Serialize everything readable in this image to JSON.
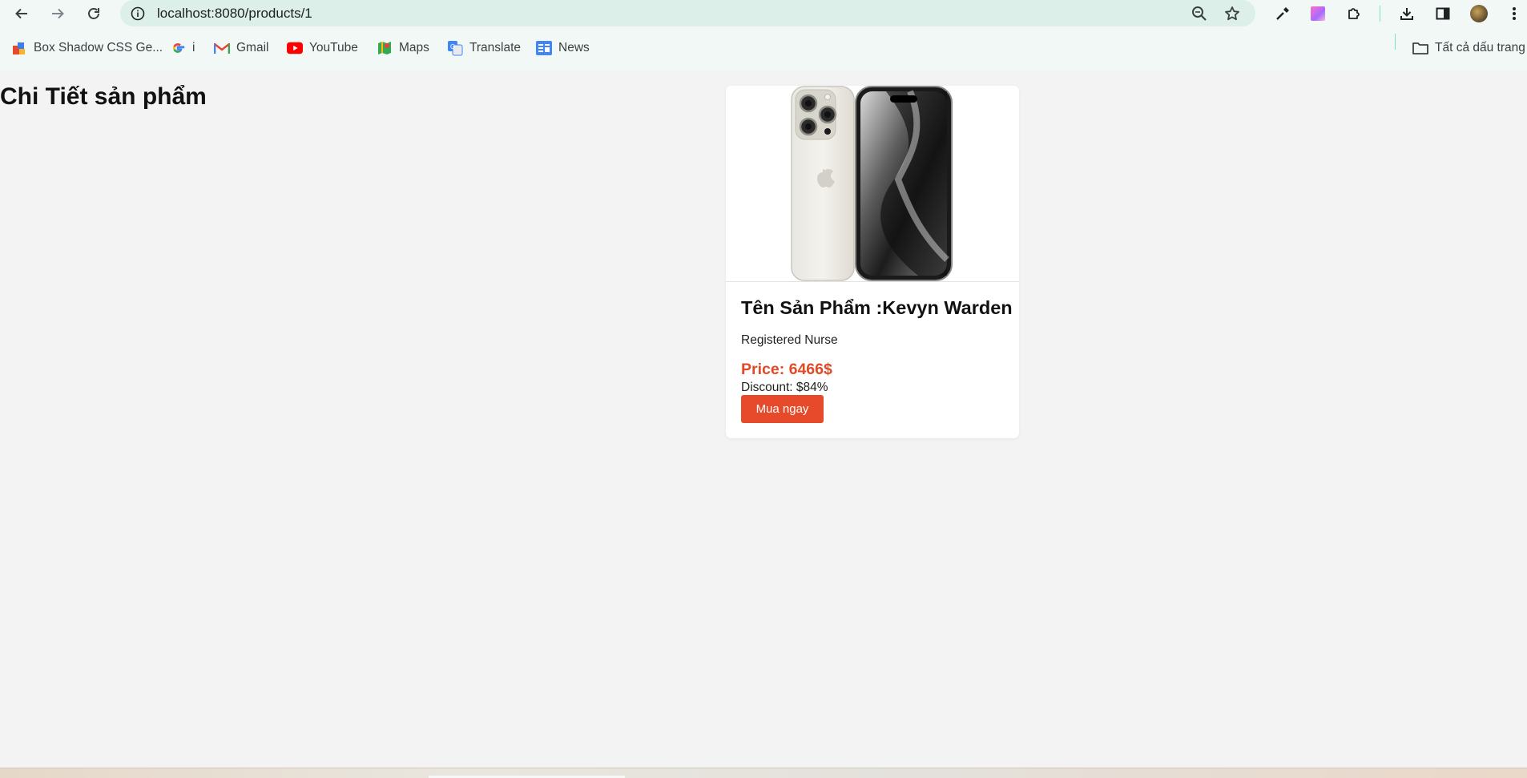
{
  "browser": {
    "url": "localhost:8080/products/1",
    "bookmarks": [
      {
        "label": "Box Shadow CSS Ge...",
        "icon": "box-shadow-icon"
      },
      {
        "label": "i",
        "icon": "google-icon"
      },
      {
        "label": "Gmail",
        "icon": "gmail-icon"
      },
      {
        "label": "YouTube",
        "icon": "youtube-icon"
      },
      {
        "label": "Maps",
        "icon": "maps-icon"
      },
      {
        "label": "Translate",
        "icon": "translate-icon"
      },
      {
        "label": "News",
        "icon": "news-icon"
      }
    ],
    "all_bookmarks_label": "Tất cả dấu trang",
    "colors": {
      "toolbar": "#f1f8f6",
      "omnibox": "#dcefe9"
    }
  },
  "page": {
    "title": "Chi Tiết sản phẩm",
    "product": {
      "name": "Tên Sản Phẩm :Kevyn Warden",
      "description": "Registered Nurse",
      "price": "Price: 6466$",
      "discount": "Discount: $84%",
      "buy_label": "Mua ngay",
      "image": "iphone-product-image"
    },
    "colors": {
      "background": "#f3f3f3",
      "price": "#e04a27",
      "button": "#e64a2a"
    }
  }
}
